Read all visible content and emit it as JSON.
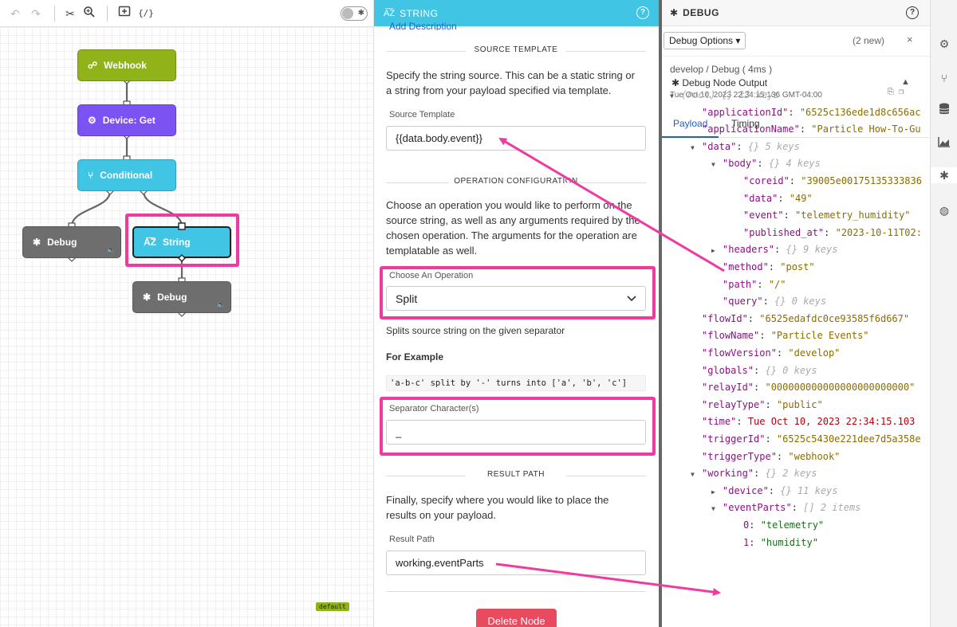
{
  "toolbar": {
    "undo_icon": "undo-icon",
    "redo_icon": "redo-icon",
    "cut_icon": "scissors-icon",
    "zoom_icon": "zoom-icon",
    "add_icon": "add-node-icon",
    "template_icon": "template-icon",
    "template_label": "{/}"
  },
  "nodes": {
    "webhook": "Webhook",
    "device": "Device: Get",
    "conditional": "Conditional",
    "debug1": "Debug",
    "string": "String",
    "debug2": "Debug"
  },
  "canvas": {
    "default_tag": "default"
  },
  "string_panel": {
    "header": "STRING",
    "add_description": "Add Description",
    "source_section": "SOURCE TEMPLATE",
    "source_help": "Specify the string source. This can be a static string or a string from your payload specified via template.",
    "source_label": "Source Template",
    "source_value": "{{data.body.event}}",
    "operation_section": "OPERATION CONFIGURATION",
    "operation_help": "Choose an operation you would like to perform on the source string, as well as any arguments required by the chosen operation. The arguments for the operation are templatable as well.",
    "operation_label": "Choose An Operation",
    "operation_value": "Split",
    "operation_desc": "Splits source string on the given separator",
    "example_title": "For Example",
    "example_code": "'a-b-c' split by '-' turns into ['a', 'b', 'c']",
    "separator_label": "Separator Character(s)",
    "separator_value": "_",
    "result_section": "RESULT PATH",
    "result_help": "Finally, specify where you would like to place the results on your payload.",
    "result_label": "Result Path",
    "result_value": "working.eventParts",
    "delete_label": "Delete Node"
  },
  "debug_panel": {
    "header": "DEBUG",
    "options_label": "Debug Options ▾",
    "new_count": "(2 new)",
    "close": "×",
    "path": "develop / Debug ( 4ms )",
    "title": "Debug Node Output",
    "timestamp": "Tue Oct 10, 2023 22:34:15.136 GMT-04:00",
    "tabs": [
      "Payload",
      "Timing"
    ],
    "tree": [
      {
        "d": 0,
        "car": "▼",
        "k": "(root)",
        "meta": "{} 13 keys",
        "root": true
      },
      {
        "d": 1,
        "k": "\"applicationId\"",
        "v": "\"6525c136ede1d8c656ac",
        "t": "s"
      },
      {
        "d": 1,
        "k": "\"applicationName\"",
        "v": "\"Particle How-To-Gu",
        "t": "s"
      },
      {
        "d": 1,
        "car": "▼",
        "k": "\"data\"",
        "meta": "{} 5 keys"
      },
      {
        "d": 2,
        "car": "▼",
        "k": "\"body\"",
        "meta": "{} 4 keys"
      },
      {
        "d": 3,
        "k": "\"coreid\"",
        "v": "\"39005e00175135333836",
        "t": "s"
      },
      {
        "d": 3,
        "k": "\"data\"",
        "v": "\"49\"",
        "t": "s"
      },
      {
        "d": 3,
        "k": "\"event\"",
        "v": "\"telemetry_humidity\"",
        "t": "s"
      },
      {
        "d": 3,
        "k": "\"published_at\"",
        "v": "\"2023-10-11T02:",
        "t": "s"
      },
      {
        "d": 2,
        "car": "▶",
        "k": "\"headers\"",
        "meta": "{} 9 keys"
      },
      {
        "d": 2,
        "k": "\"method\"",
        "v": "\"post\"",
        "t": "s"
      },
      {
        "d": 2,
        "k": "\"path\"",
        "v": "\"/\"",
        "t": "s"
      },
      {
        "d": 2,
        "k": "\"query\"",
        "meta": "{} 0 keys"
      },
      {
        "d": 1,
        "k": "\"flowId\"",
        "v": "\"6525edafdc0ce93585f6d667\"",
        "t": "s"
      },
      {
        "d": 1,
        "k": "\"flowName\"",
        "v": "\"Particle Events\"",
        "t": "s"
      },
      {
        "d": 1,
        "k": "\"flowVersion\"",
        "v": "\"develop\"",
        "t": "s"
      },
      {
        "d": 1,
        "k": "\"globals\"",
        "meta": "{} 0 keys"
      },
      {
        "d": 1,
        "k": "\"relayId\"",
        "v": "\"000000000000000000000000\"",
        "t": "s"
      },
      {
        "d": 1,
        "k": "\"relayType\"",
        "v": "\"public\"",
        "t": "s"
      },
      {
        "d": 1,
        "k": "\"time\"",
        "v": "Tue Oct 10, 2023 22:34:15.103",
        "t": "n"
      },
      {
        "d": 1,
        "k": "\"triggerId\"",
        "v": "\"6525c5430e221dee7d5a358e",
        "t": "s"
      },
      {
        "d": 1,
        "k": "\"triggerType\"",
        "v": "\"webhook\"",
        "t": "s"
      },
      {
        "d": 1,
        "car": "▼",
        "k": "\"working\"",
        "meta": "{} 2 keys"
      },
      {
        "d": 2,
        "car": "▶",
        "k": "\"device\"",
        "meta": "{} 11 keys"
      },
      {
        "d": 2,
        "car": "▼",
        "k": "\"eventParts\"",
        "meta": "[] 2 items"
      },
      {
        "d": 3,
        "k": "0",
        "v": "\"telemetry\"",
        "t": "s",
        "plain": true
      },
      {
        "d": 3,
        "k": "1",
        "v": "\"humidity\"",
        "t": "s",
        "plain": true
      }
    ]
  },
  "sidebar": [
    "settings-icon",
    "branch-icon",
    "database-icon",
    "chart-icon",
    "debug-icon",
    "globe-icon"
  ],
  "colors": {
    "accent": "#40c6e4",
    "highlight": "#ee3aa1",
    "webhook": "#8fb319",
    "device": "#7c53f2",
    "debug": "#6e6e6e",
    "delete": "#e84a5f"
  }
}
